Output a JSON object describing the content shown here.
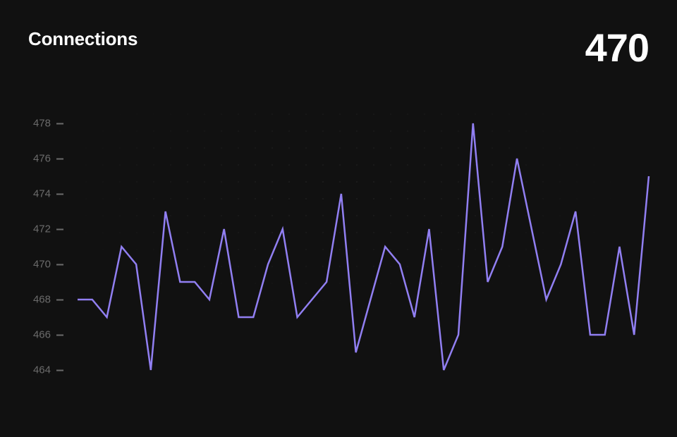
{
  "header": {
    "title": "Connections",
    "current_value": "470"
  },
  "chart": {
    "y_ticks": [
      478,
      476,
      474,
      472,
      470,
      468,
      466,
      464
    ],
    "line_color": "#917ff2"
  },
  "chart_data": {
    "type": "line",
    "title": "Connections",
    "xlabel": "",
    "ylabel": "",
    "ylim": [
      463,
      479
    ],
    "x": [
      0,
      1,
      2,
      3,
      4,
      5,
      6,
      7,
      8,
      9,
      10,
      11,
      12,
      13,
      14,
      15,
      16,
      17,
      18,
      19,
      20,
      21,
      22,
      23,
      24,
      25,
      26,
      27,
      28,
      29,
      30,
      31,
      32,
      33,
      34,
      35,
      36,
      37,
      38,
      39
    ],
    "values": [
      468,
      468,
      467,
      471,
      470,
      464,
      473,
      469,
      469,
      468,
      472,
      467,
      467,
      470,
      472,
      467,
      468,
      469,
      474,
      465,
      468,
      471,
      470,
      467,
      472,
      464,
      466,
      478,
      469,
      471,
      476,
      472,
      468,
      470,
      473,
      466,
      466,
      471,
      466,
      475
    ]
  }
}
